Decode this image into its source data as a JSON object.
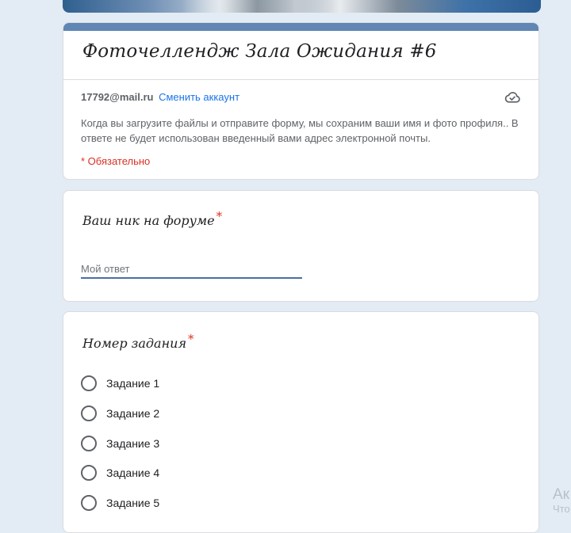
{
  "header": {
    "title": "Фоточеллендж Зала Ожидания #6",
    "account_email": "17792@mail.ru",
    "switch_account": "Сменить аккаунт",
    "notice": "Когда вы загрузите файлы и отправите форму, мы сохраним ваши имя и фото профиля.. В ответе не будет использован введенный вами адрес электронной почты.",
    "required_note": "* Обязательно",
    "cloud_icon": "cloud-check-icon"
  },
  "question1": {
    "title": "Ваш ник на форуме",
    "required": "*",
    "placeholder": "Мой ответ"
  },
  "question2": {
    "title": "Номер задания",
    "required": "*",
    "options": [
      "Задание 1",
      "Задание 2",
      "Задание 3",
      "Задание 4",
      "Задание 5"
    ]
  },
  "watermark": {
    "line1": "Ак",
    "line2": "Что"
  },
  "colors": {
    "accent": "#5f86b4",
    "background": "#e3ebf4",
    "required": "#d93025",
    "link": "#1a73e8"
  }
}
